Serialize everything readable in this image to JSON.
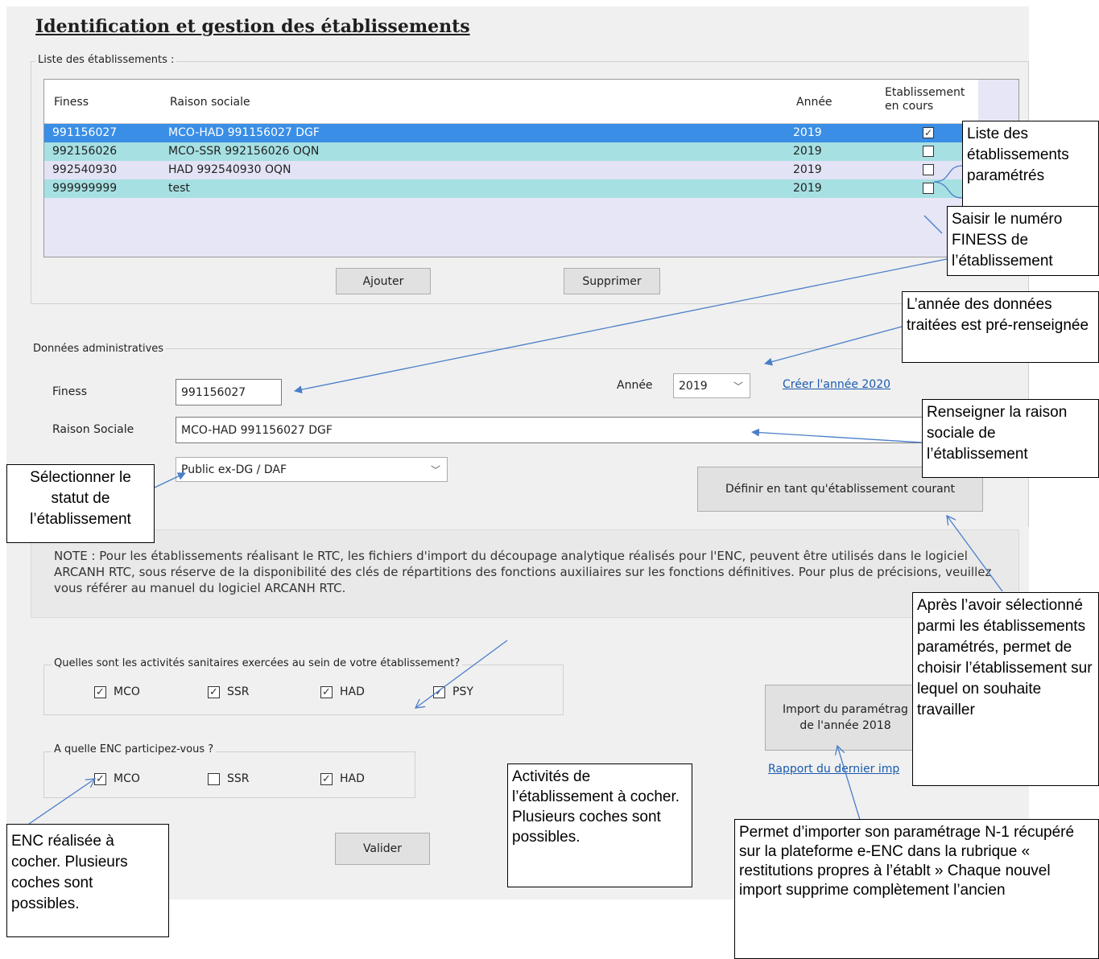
{
  "title": "Identification et gestion des établissements",
  "list_group_label": "Liste des établissements :",
  "grid": {
    "headers": {
      "finess": "Finess",
      "raison": "Raison sociale",
      "annee": "Année",
      "encours": "Etablissement en cours"
    },
    "rows": [
      {
        "finess": "991156027",
        "raison": "MCO-HAD 991156027 DGF",
        "annee": "2019",
        "checked": true,
        "selected": true
      },
      {
        "finess": "992156026",
        "raison": "MCO-SSR 992156026 OQN",
        "annee": "2019",
        "checked": false
      },
      {
        "finess": "992540930",
        "raison": "HAD 992540930 OQN",
        "annee": "2019",
        "checked": false
      },
      {
        "finess": "999999999",
        "raison": "test",
        "annee": "2019",
        "checked": false
      }
    ]
  },
  "buttons": {
    "ajouter": "Ajouter",
    "supprimer": "Supprimer",
    "definir": "Définir en tant qu'établissement courant",
    "import_l1": "Import du paramétrag",
    "import_l2": "de l'année 2018",
    "valider": "Valider"
  },
  "admin": {
    "group_label": "Données administratives",
    "finess_label": "Finess",
    "finess_value": "991156027",
    "annee_label": "Année",
    "annee_value": "2019",
    "creer_link": "Créer l'année 2020",
    "raison_label": "Raison Sociale",
    "raison_value": "MCO-HAD 991156027 DGF",
    "statut_value": "Public ex-DG / DAF"
  },
  "note": "NOTE : Pour les établissements réalisant le RTC, les fichiers d'import du découpage analytique réalisés pour l'ENC, peuvent être utilisés dans le logiciel ARCANH RTC, sous réserve de la disponibilité des clés de répartitions des fonctions auxiliaires sur les fonctions définitives. Pour plus de précisions, veuillez vous référer au manuel du logiciel ARCANH RTC.",
  "activites": {
    "label": "Quelles sont les activités sanitaires exercées au sein de votre établissement?",
    "items": [
      {
        "label": "MCO",
        "checked": true
      },
      {
        "label": "SSR",
        "checked": true
      },
      {
        "label": "HAD",
        "checked": true
      },
      {
        "label": "PSY",
        "checked": true
      }
    ]
  },
  "enc": {
    "label": "A quelle ENC participez-vous ?",
    "items": [
      {
        "label": "MCO",
        "checked": true
      },
      {
        "label": "SSR",
        "checked": false
      },
      {
        "label": "HAD",
        "checked": true
      }
    ]
  },
  "rapport_link": "Rapport du dernier imp",
  "callouts": {
    "liste": "Liste des établissements paramétrés",
    "saisir": "Saisir le numéro FINESS de l’établissement",
    "annee": "L’année des données traitées est pré-renseignée",
    "raison": "Renseigner la raison sociale de l’établissement",
    "statut": "Sélectionner le statut de l’établissement",
    "apres": "Après l’avoir sélectionné parmi les établissements paramétrés, permet de choisir l’établissement sur lequel on souhaite travailler",
    "activites": "Activités de l’établissement à cocher. Plusieurs coches sont possibles.",
    "enc": "ENC réalisée à cocher. Plusieurs coches sont possibles.",
    "import": "Permet d’importer son paramétrage N-1 récupéré sur la plateforme e-ENC dans la rubrique « restitutions propres à l’établt » Chaque nouvel import supprime complètement l’ancien"
  },
  "colors": {
    "selected_row": "#3a8ee6",
    "teal_row": "#a6e0e2",
    "lavender_row": "#e3e3f6",
    "link": "#1a5aaf",
    "arrow": "#4a7ec9"
  }
}
